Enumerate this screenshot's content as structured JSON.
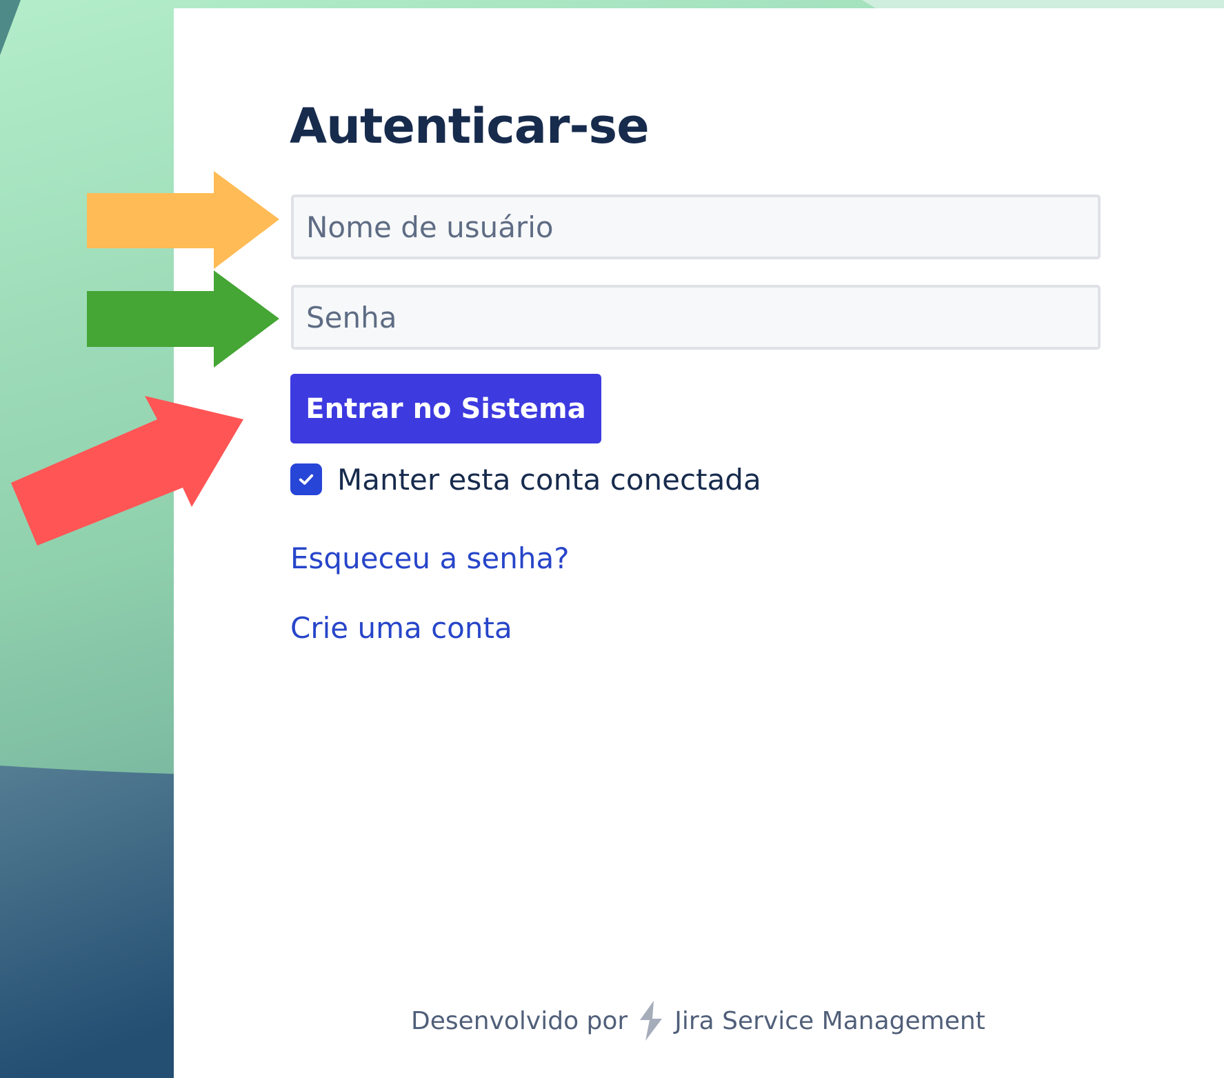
{
  "login": {
    "title": "Autenticar-se",
    "username_placeholder": "Nome de usuário",
    "password_placeholder": "Senha",
    "submit_label": "Entrar no Sistema",
    "remember_label": "Manter esta conta conectada",
    "remember_checked": true,
    "forgot_password_link": "Esqueceu a senha?",
    "create_account_link": "Crie uma conta"
  },
  "footer": {
    "powered_by": "Desenvolvido por",
    "product_name": "Jira Service Management",
    "logo_icon": "jira-service-management-icon"
  },
  "annotations": {
    "username_arrow_color": "#ffbb55",
    "password_arrow_color": "#45a535",
    "submit_arrow_color": "#ff5555",
    "button_color": "#3d3ae0",
    "link_color": "#2745c9"
  }
}
